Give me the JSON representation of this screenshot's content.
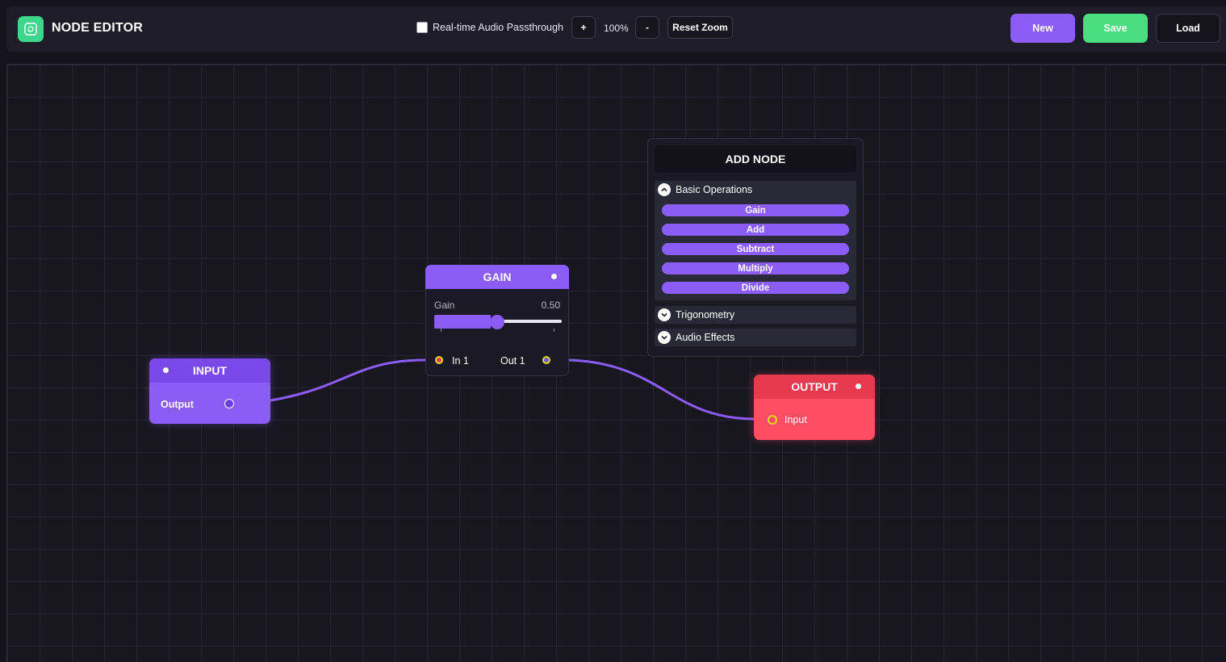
{
  "app": {
    "title": "NODE EDITOR",
    "logo_icon": "refresh-square-icon"
  },
  "toolbar": {
    "passthrough_label": "Real-time Audio Passthrough",
    "passthrough_checked": false,
    "zoom_in": "+",
    "zoom_level": "100%",
    "zoom_out": "-",
    "reset_zoom": "Reset Zoom",
    "new": "New",
    "save": "Save",
    "load": "Load"
  },
  "colors": {
    "accent": "#8b5cf6",
    "save": "#4ade80",
    "output": "#ff4d63",
    "port_ring": "#e5d41a"
  },
  "nodes": {
    "input": {
      "title": "INPUT",
      "port_label": "Output"
    },
    "gain": {
      "title": "GAIN",
      "param_label": "Gain",
      "param_value": "0.50",
      "in_label": "In 1",
      "out_label": "Out 1"
    },
    "output": {
      "title": "OUTPUT",
      "port_label": "Input"
    }
  },
  "add_node": {
    "title": "ADD NODE",
    "categories": [
      {
        "label": "Basic Operations",
        "expanded": true,
        "items": [
          "Gain",
          "Add",
          "Subtract",
          "Multiply",
          "Divide"
        ]
      },
      {
        "label": "Trigonometry",
        "expanded": false,
        "items": []
      },
      {
        "label": "Audio Effects",
        "expanded": false,
        "items": []
      }
    ]
  }
}
